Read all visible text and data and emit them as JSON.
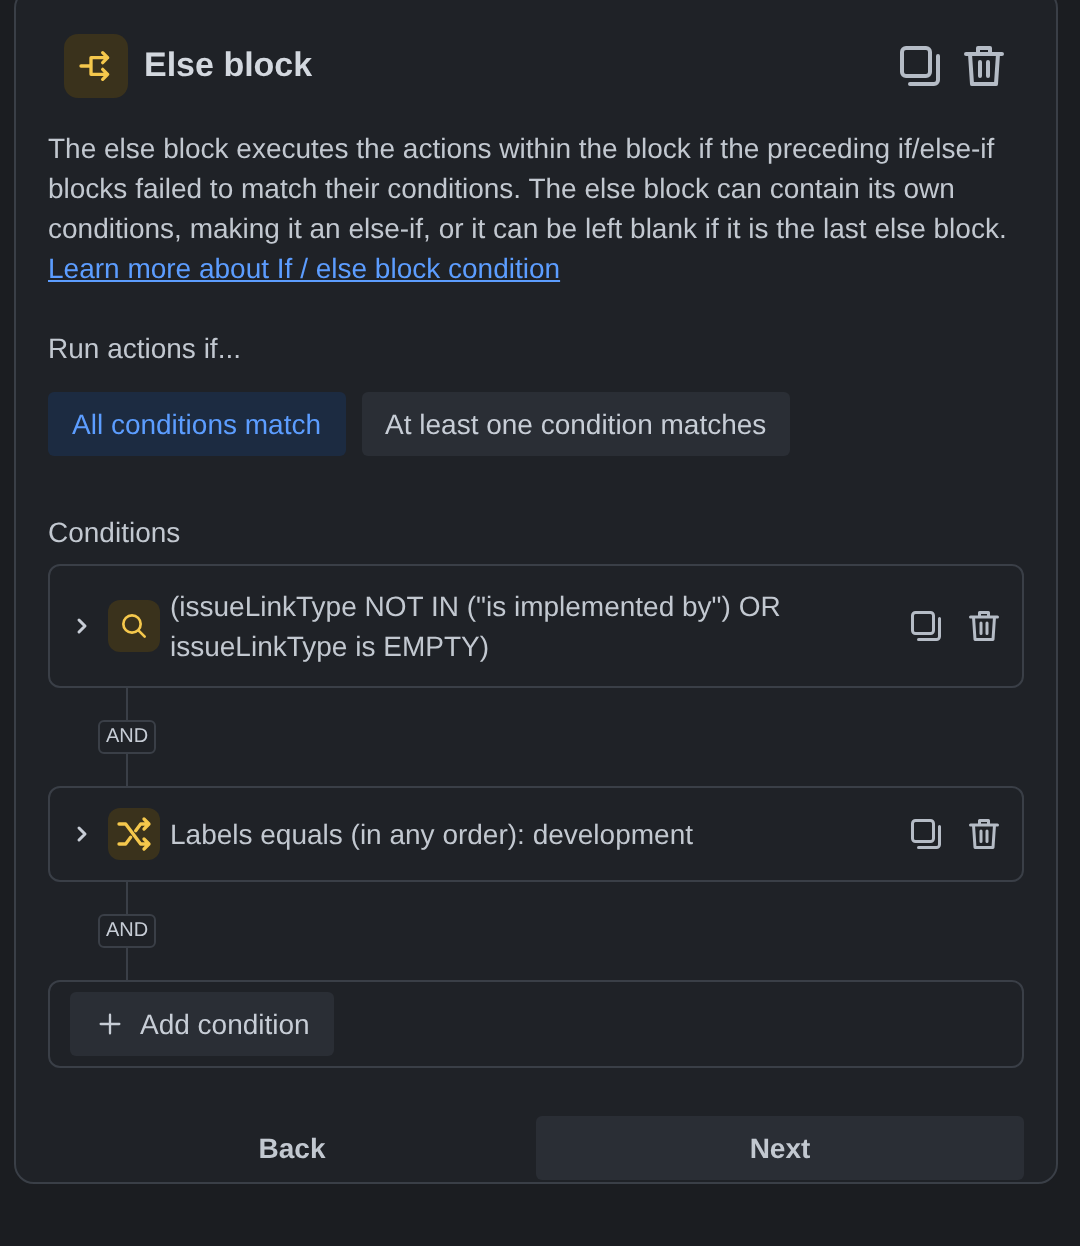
{
  "header": {
    "title": "Else block"
  },
  "description": {
    "text": "The else block executes the actions within the block if the preceding if/else-if blocks failed to match their conditions. The else block can contain its own conditions, making it an else-if, or it can be left blank if it is the last else block.",
    "link": "Learn more about If / else block condition"
  },
  "run_actions": {
    "label": "Run actions if...",
    "options": [
      {
        "label": "All conditions match",
        "selected": true
      },
      {
        "label": "At least one condition matches",
        "selected": false
      }
    ]
  },
  "conditions": {
    "label": "Conditions",
    "items": [
      {
        "kind": "search",
        "text": "(issueLinkType NOT IN (\"is implemented by\") OR issueLinkType is EMPTY)",
        "connector": "AND"
      },
      {
        "kind": "shuffle",
        "text": "Labels equals (in any order): development",
        "connector": "AND"
      }
    ],
    "add_button": "Add condition"
  },
  "footer": {
    "back": "Back",
    "next": "Next"
  }
}
